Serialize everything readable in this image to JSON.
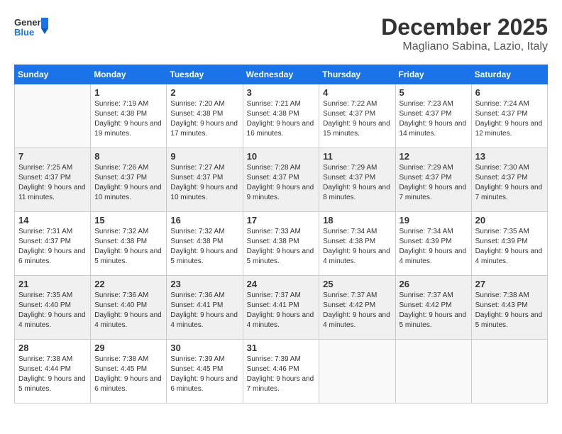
{
  "logo": {
    "general": "General",
    "blue": "Blue"
  },
  "title": "December 2025",
  "subtitle": "Magliano Sabina, Lazio, Italy",
  "weekdays": [
    "Sunday",
    "Monday",
    "Tuesday",
    "Wednesday",
    "Thursday",
    "Friday",
    "Saturday"
  ],
  "weeks": [
    [
      {
        "day": "",
        "info": ""
      },
      {
        "day": "1",
        "info": "Sunrise: 7:19 AM\nSunset: 4:38 PM\nDaylight: 9 hours and 19 minutes."
      },
      {
        "day": "2",
        "info": "Sunrise: 7:20 AM\nSunset: 4:38 PM\nDaylight: 9 hours and 17 minutes."
      },
      {
        "day": "3",
        "info": "Sunrise: 7:21 AM\nSunset: 4:38 PM\nDaylight: 9 hours and 16 minutes."
      },
      {
        "day": "4",
        "info": "Sunrise: 7:22 AM\nSunset: 4:37 PM\nDaylight: 9 hours and 15 minutes."
      },
      {
        "day": "5",
        "info": "Sunrise: 7:23 AM\nSunset: 4:37 PM\nDaylight: 9 hours and 14 minutes."
      },
      {
        "day": "6",
        "info": "Sunrise: 7:24 AM\nSunset: 4:37 PM\nDaylight: 9 hours and 12 minutes."
      }
    ],
    [
      {
        "day": "7",
        "info": "Sunrise: 7:25 AM\nSunset: 4:37 PM\nDaylight: 9 hours and 11 minutes."
      },
      {
        "day": "8",
        "info": "Sunrise: 7:26 AM\nSunset: 4:37 PM\nDaylight: 9 hours and 10 minutes."
      },
      {
        "day": "9",
        "info": "Sunrise: 7:27 AM\nSunset: 4:37 PM\nDaylight: 9 hours and 10 minutes."
      },
      {
        "day": "10",
        "info": "Sunrise: 7:28 AM\nSunset: 4:37 PM\nDaylight: 9 hours and 9 minutes."
      },
      {
        "day": "11",
        "info": "Sunrise: 7:29 AM\nSunset: 4:37 PM\nDaylight: 9 hours and 8 minutes."
      },
      {
        "day": "12",
        "info": "Sunrise: 7:29 AM\nSunset: 4:37 PM\nDaylight: 9 hours and 7 minutes."
      },
      {
        "day": "13",
        "info": "Sunrise: 7:30 AM\nSunset: 4:37 PM\nDaylight: 9 hours and 7 minutes."
      }
    ],
    [
      {
        "day": "14",
        "info": "Sunrise: 7:31 AM\nSunset: 4:37 PM\nDaylight: 9 hours and 6 minutes."
      },
      {
        "day": "15",
        "info": "Sunrise: 7:32 AM\nSunset: 4:38 PM\nDaylight: 9 hours and 5 minutes."
      },
      {
        "day": "16",
        "info": "Sunrise: 7:32 AM\nSunset: 4:38 PM\nDaylight: 9 hours and 5 minutes."
      },
      {
        "day": "17",
        "info": "Sunrise: 7:33 AM\nSunset: 4:38 PM\nDaylight: 9 hours and 5 minutes."
      },
      {
        "day": "18",
        "info": "Sunrise: 7:34 AM\nSunset: 4:38 PM\nDaylight: 9 hours and 4 minutes."
      },
      {
        "day": "19",
        "info": "Sunrise: 7:34 AM\nSunset: 4:39 PM\nDaylight: 9 hours and 4 minutes."
      },
      {
        "day": "20",
        "info": "Sunrise: 7:35 AM\nSunset: 4:39 PM\nDaylight: 9 hours and 4 minutes."
      }
    ],
    [
      {
        "day": "21",
        "info": "Sunrise: 7:35 AM\nSunset: 4:40 PM\nDaylight: 9 hours and 4 minutes."
      },
      {
        "day": "22",
        "info": "Sunrise: 7:36 AM\nSunset: 4:40 PM\nDaylight: 9 hours and 4 minutes."
      },
      {
        "day": "23",
        "info": "Sunrise: 7:36 AM\nSunset: 4:41 PM\nDaylight: 9 hours and 4 minutes."
      },
      {
        "day": "24",
        "info": "Sunrise: 7:37 AM\nSunset: 4:41 PM\nDaylight: 9 hours and 4 minutes."
      },
      {
        "day": "25",
        "info": "Sunrise: 7:37 AM\nSunset: 4:42 PM\nDaylight: 9 hours and 4 minutes."
      },
      {
        "day": "26",
        "info": "Sunrise: 7:37 AM\nSunset: 4:42 PM\nDaylight: 9 hours and 5 minutes."
      },
      {
        "day": "27",
        "info": "Sunrise: 7:38 AM\nSunset: 4:43 PM\nDaylight: 9 hours and 5 minutes."
      }
    ],
    [
      {
        "day": "28",
        "info": "Sunrise: 7:38 AM\nSunset: 4:44 PM\nDaylight: 9 hours and 5 minutes."
      },
      {
        "day": "29",
        "info": "Sunrise: 7:38 AM\nSunset: 4:45 PM\nDaylight: 9 hours and 6 minutes."
      },
      {
        "day": "30",
        "info": "Sunrise: 7:39 AM\nSunset: 4:45 PM\nDaylight: 9 hours and 6 minutes."
      },
      {
        "day": "31",
        "info": "Sunrise: 7:39 AM\nSunset: 4:46 PM\nDaylight: 9 hours and 7 minutes."
      },
      {
        "day": "",
        "info": ""
      },
      {
        "day": "",
        "info": ""
      },
      {
        "day": "",
        "info": ""
      }
    ]
  ]
}
